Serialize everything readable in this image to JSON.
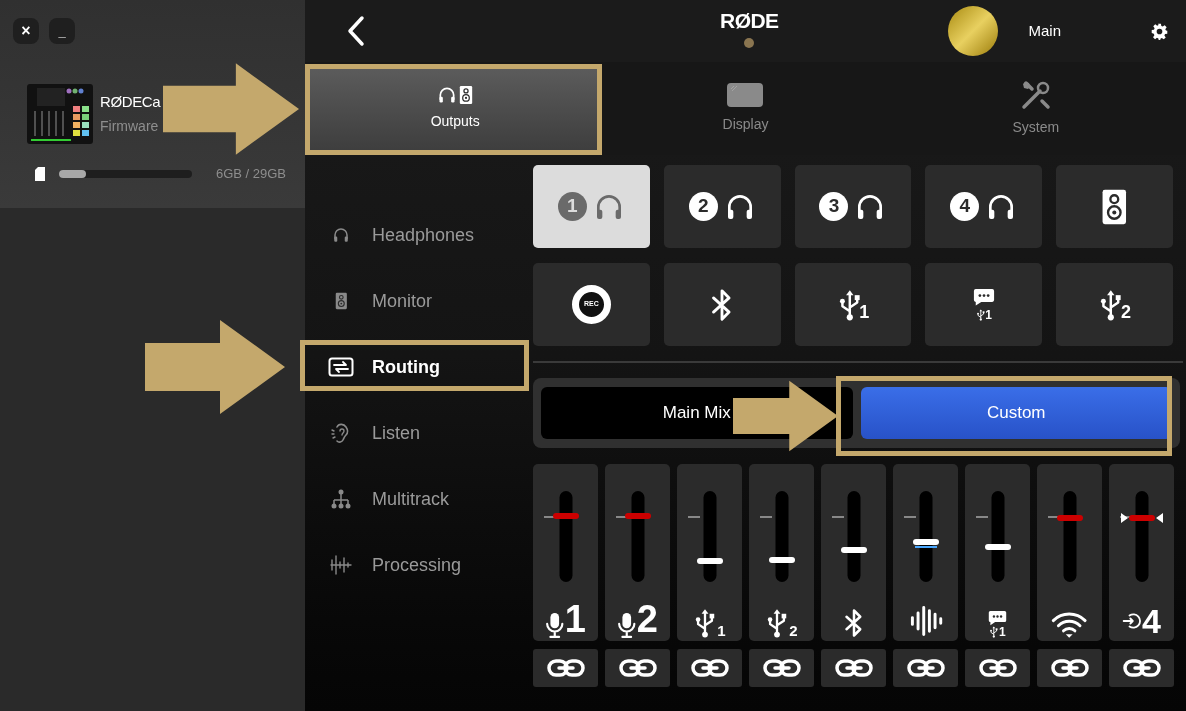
{
  "window_buttons": [
    {
      "kind": "close",
      "label": "×"
    },
    {
      "kind": "minimize",
      "label": "_"
    }
  ],
  "device": {
    "name": "RØDECa",
    "subtitle": "Firmware",
    "storage": {
      "level": 0.2,
      "reading": "6GB / 29GB"
    }
  },
  "header": {
    "logo": "RØDE",
    "profile": "Main"
  },
  "tabs": [
    {
      "label": "Outputs",
      "kind": "outputs",
      "selected": true
    },
    {
      "label": "Display",
      "kind": "display",
      "selected": false
    },
    {
      "label": "System",
      "kind": "system",
      "selected": false
    }
  ],
  "sidebar": {
    "items": [
      {
        "label": "Headphones",
        "kind": "headphones",
        "selected": false
      },
      {
        "label": "Monitor",
        "kind": "speaker",
        "selected": false
      },
      {
        "label": "Routing",
        "kind": "routing",
        "selected": true
      },
      {
        "label": "Listen",
        "kind": "listen",
        "selected": false
      },
      {
        "label": "Multitrack",
        "kind": "multitrack",
        "selected": false
      },
      {
        "label": "Processing",
        "kind": "processing",
        "selected": false
      }
    ]
  },
  "outputs": [
    {
      "kind": "headphones",
      "number": "1",
      "selected": true
    },
    {
      "kind": "headphones",
      "number": "2",
      "selected": false
    },
    {
      "kind": "headphones",
      "number": "3",
      "selected": false
    },
    {
      "kind": "headphones",
      "number": "4",
      "selected": false
    },
    {
      "kind": "speaker",
      "selected": false
    },
    {
      "kind": "rec",
      "label": "REC",
      "selected": false
    },
    {
      "kind": "bluetooth",
      "selected": false
    },
    {
      "kind": "usb",
      "number": "1",
      "selected": false
    },
    {
      "kind": "chat-usb",
      "number": "1",
      "selected": false
    },
    {
      "kind": "usb",
      "number": "2",
      "selected": false
    }
  ],
  "mix_modes": [
    {
      "label": "Main Mix",
      "selected": false
    },
    {
      "label": "Custom",
      "selected": true
    }
  ],
  "faders": [
    {
      "kind": "mic",
      "number": "1",
      "level": 0.72,
      "color": "#cc0000",
      "markers": false,
      "glow": false
    },
    {
      "kind": "mic",
      "number": "2",
      "level": 0.72,
      "color": "#cc0000",
      "markers": false,
      "glow": false
    },
    {
      "kind": "usb",
      "number": "1",
      "level": 0.23,
      "color": "#ffffff",
      "markers": false,
      "glow": false
    },
    {
      "kind": "usb",
      "number": "2",
      "level": 0.24,
      "color": "#ffffff",
      "markers": false,
      "glow": false
    },
    {
      "kind": "bluetooth",
      "level": 0.35,
      "color": "#ffffff",
      "markers": false,
      "glow": false
    },
    {
      "kind": "wave",
      "level": 0.44,
      "color": "#ffffff",
      "markers": false,
      "glow": true
    },
    {
      "kind": "chat-usb",
      "number": "1",
      "level": 0.39,
      "color": "#ffffff",
      "markers": false,
      "glow": false
    },
    {
      "kind": "wifi",
      "level": 0.7,
      "color": "#cc0000",
      "markers": false,
      "glow": false
    },
    {
      "kind": "input",
      "number": "4",
      "level": 0.7,
      "color": "#cc0000",
      "markers": true,
      "glow": false
    }
  ]
}
